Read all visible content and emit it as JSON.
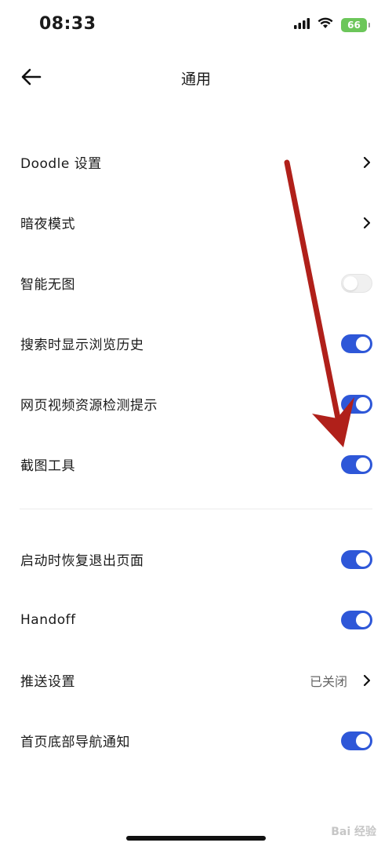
{
  "status_bar": {
    "time": "08:33",
    "battery": "66",
    "icons": [
      "signal-icon",
      "wifi-icon",
      "battery-icon"
    ]
  },
  "nav": {
    "title": "通用",
    "back_icon": "back-arrow-icon"
  },
  "section1": [
    {
      "label": "Doodle 设置",
      "control": "chevron"
    },
    {
      "label": "暗夜模式",
      "control": "chevron"
    },
    {
      "label": "智能无图",
      "control": "toggle",
      "on": false
    },
    {
      "label": "搜索时显示浏览历史",
      "control": "toggle",
      "on": true
    },
    {
      "label": "网页视频资源检测提示",
      "control": "toggle",
      "on": true
    },
    {
      "label": "截图工具",
      "control": "toggle",
      "on": true
    }
  ],
  "section2": [
    {
      "label": "启动时恢复退出页面",
      "control": "toggle",
      "on": true
    },
    {
      "label": "Handoff",
      "control": "toggle",
      "on": true
    },
    {
      "label": "推送设置",
      "control": "chevron",
      "value": "已关闭"
    },
    {
      "label": "首页底部导航通知",
      "control": "toggle",
      "on": true
    }
  ],
  "watermark": "Bai 经验",
  "colors": {
    "accent": "#2e57d8",
    "toggle_off": "#f0f0f0",
    "annotation_arrow": "#b0201a",
    "battery": "#6cc65a"
  }
}
